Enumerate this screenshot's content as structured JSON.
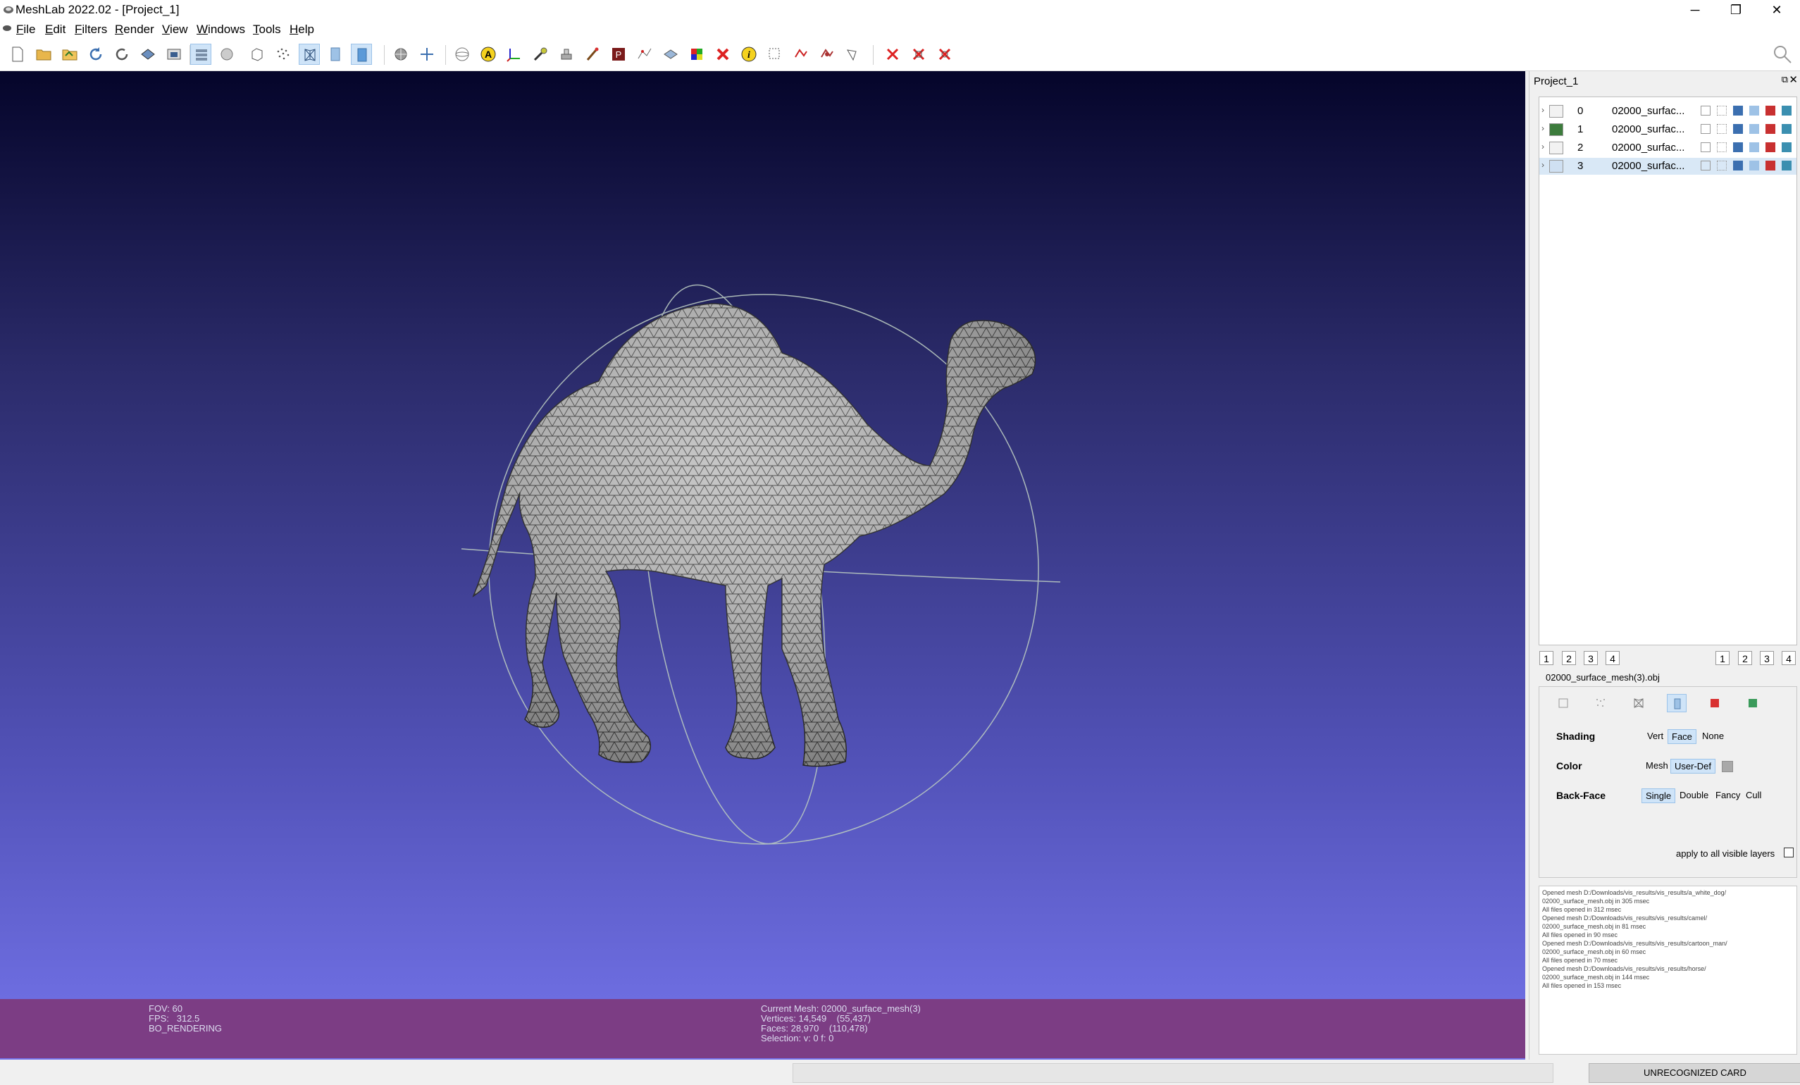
{
  "window": {
    "title": "MeshLab 2022.02 - [Project_1]",
    "controls": {
      "minimize": "─",
      "maximize": "❐",
      "close": "✕"
    }
  },
  "menu": {
    "items": [
      "File",
      "Edit",
      "Filters",
      "Render",
      "View",
      "Windows",
      "Tools",
      "Help"
    ]
  },
  "viewport": {
    "info_left": [
      "FOV: 60",
      "FPS:   312.5",
      "BO_RENDERING"
    ],
    "info_center": [
      "Current Mesh: 02000_surface_mesh(3)",
      "Vertices: 14,549    (55,437)",
      "Faces: 28,970    (110,478)",
      "Selection: v: 0 f: 0"
    ],
    "colors": {
      "background_top": "#05052a",
      "background_bottom": "#7474ea",
      "info_bar": "#7c3d84"
    }
  },
  "panel": {
    "title": "Project_1",
    "float_icon": "⧉",
    "close_icon": "✕",
    "layers": [
      {
        "index": "0",
        "name": "02000_surfac..."
      },
      {
        "index": "1",
        "name": "02000_surfac..."
      },
      {
        "index": "2",
        "name": "02000_surfac..."
      },
      {
        "index": "3",
        "name": "02000_surfac..."
      }
    ],
    "view_buttons_left": [
      "1",
      "2",
      "3",
      "4"
    ],
    "view_buttons_right": [
      "1",
      "2",
      "3",
      "4"
    ],
    "mesh_file": "02000_surface_mesh(3).obj",
    "render": {
      "shading": {
        "label": "Shading",
        "options": [
          "Vert",
          "Face",
          "None"
        ],
        "selected": "Face"
      },
      "color": {
        "label": "Color",
        "options": [
          "Mesh",
          "User-Def"
        ],
        "selected": "User-Def"
      },
      "backface": {
        "label": "Back-Face",
        "options": [
          "Single",
          "Double",
          "Fancy",
          "Cull"
        ],
        "selected": "Single"
      },
      "apply_all": "apply to all visible layers"
    },
    "log": [
      "Opened mesh D:/Downloads/vis_results/vis_results/a_white_dog/",
      "02000_surface_mesh.obj in 305 msec",
      "All files opened in 312 msec",
      "Opened mesh D:/Downloads/vis_results/vis_results/camel/",
      "02000_surface_mesh.obj in 81 msec",
      "All files opened in 90 msec",
      "Opened mesh D:/Downloads/vis_results/vis_results/cartoon_man/",
      "02000_surface_mesh.obj in 60 msec",
      "All files opened in 70 msec",
      "Opened mesh D:/Downloads/vis_results/vis_results/horse/",
      "02000_surface_mesh.obj in 144 msec",
      "All files opened in 153 msec"
    ]
  },
  "statusbar": {
    "card": "UNRECOGNIZED CARD"
  }
}
